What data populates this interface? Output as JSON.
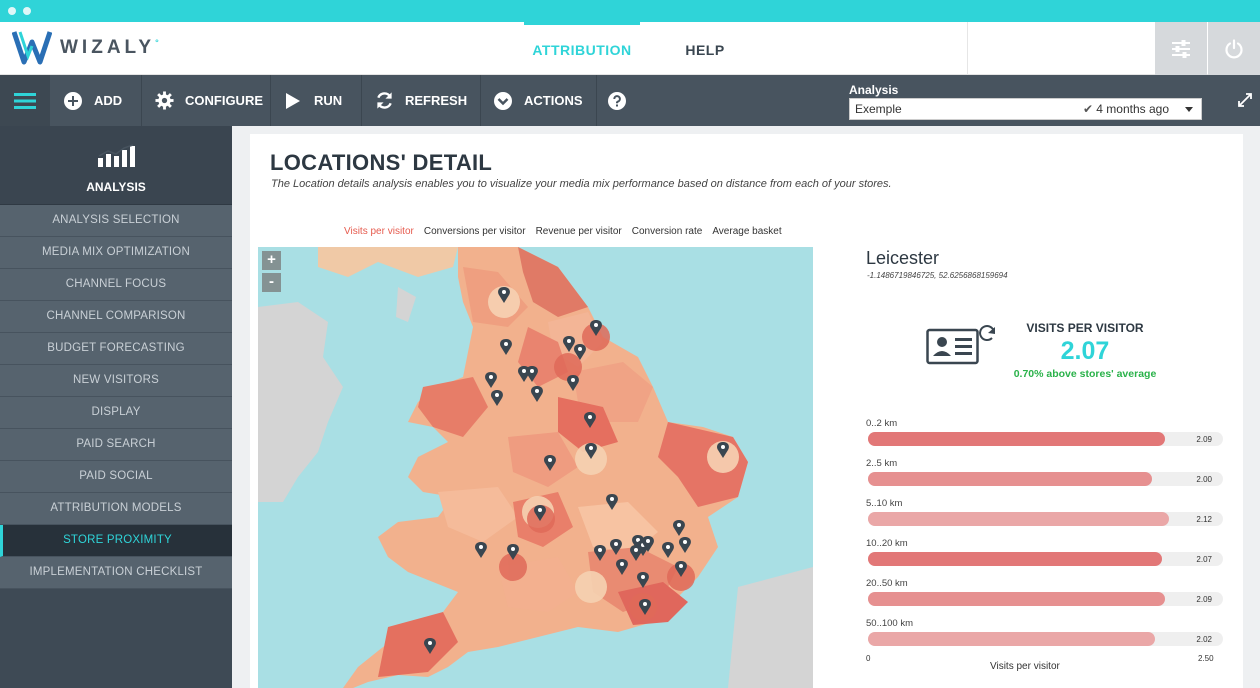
{
  "brand": {
    "name": "WIZALY",
    "mark": "°",
    "accent": "#2fd4d8"
  },
  "topnav": {
    "tabs": [
      {
        "label": "ATTRIBUTION",
        "active": true
      },
      {
        "label": "HELP",
        "active": false
      }
    ],
    "icons": [
      "sliders-icon",
      "power-icon"
    ]
  },
  "toolbar": {
    "buttons": [
      {
        "label": "ADD",
        "icon": "plus-circle-icon"
      },
      {
        "label": "CONFIGURE",
        "icon": "gear-icon"
      },
      {
        "label": "RUN",
        "icon": "play-icon"
      },
      {
        "label": "REFRESH",
        "icon": "refresh-icon"
      },
      {
        "label": "ACTIONS",
        "icon": "chevron-circle-icon"
      }
    ],
    "help_icon": "question-icon",
    "analysis": {
      "label": "Analysis",
      "selected": "Exemple",
      "updated": "4 months ago"
    }
  },
  "sidebar": {
    "title": "ANALYSIS",
    "items": [
      {
        "label": "ANALYSIS SELECTION"
      },
      {
        "label": "MEDIA MIX OPTIMIZATION"
      },
      {
        "label": "CHANNEL FOCUS"
      },
      {
        "label": "CHANNEL COMPARISON"
      },
      {
        "label": "BUDGET FORECASTING"
      },
      {
        "label": "NEW VISITORS"
      },
      {
        "label": "DISPLAY"
      },
      {
        "label": "PAID SEARCH"
      },
      {
        "label": "PAID SOCIAL"
      },
      {
        "label": "ATTRIBUTION MODELS"
      },
      {
        "label": "STORE PROXIMITY",
        "active": true
      },
      {
        "label": "IMPLEMENTATION CHECKLIST"
      }
    ]
  },
  "page": {
    "title": "LOCATIONS' DETAIL",
    "subtitle": "The Location details analysis enables you to visualize your media mix performance based on distance from each of your stores.",
    "metric_tabs": [
      {
        "label": "Visits per visitor",
        "active": true
      },
      {
        "label": "Conversions per visitor"
      },
      {
        "label": "Revenue per visitor"
      },
      {
        "label": "Conversion rate"
      },
      {
        "label": "Average basket"
      }
    ],
    "map": {
      "zoom_in": "+",
      "zoom_out": "-"
    }
  },
  "detail": {
    "city": "Leicester",
    "coords": "-1.1486719846725, 52.6256868159694",
    "kpi_title": "VISITS PER VISITOR",
    "kpi_value": "2.07",
    "kpi_delta": "0.70% above stores' average"
  },
  "chart_data": {
    "type": "bar",
    "orientation": "horizontal",
    "categories": [
      "0..2 km",
      "2..5 km",
      "5..10 km",
      "10..20 km",
      "20..50 km",
      "50..100 km"
    ],
    "values": [
      2.09,
      2.0,
      2.12,
      2.07,
      2.09,
      2.02
    ],
    "value_labels": [
      "2.09",
      "2.00",
      "2.12",
      "2.07",
      "2.09",
      "2.02"
    ],
    "colors": [
      "#e27777",
      "#e69090",
      "#eaa7a7",
      "#e27777",
      "#e69090",
      "#eaa7a7"
    ],
    "xlim": [
      0,
      2.5
    ],
    "axis_min_label": "0",
    "axis_max_label": "2.50",
    "xlabel": "Visits per visitor"
  }
}
